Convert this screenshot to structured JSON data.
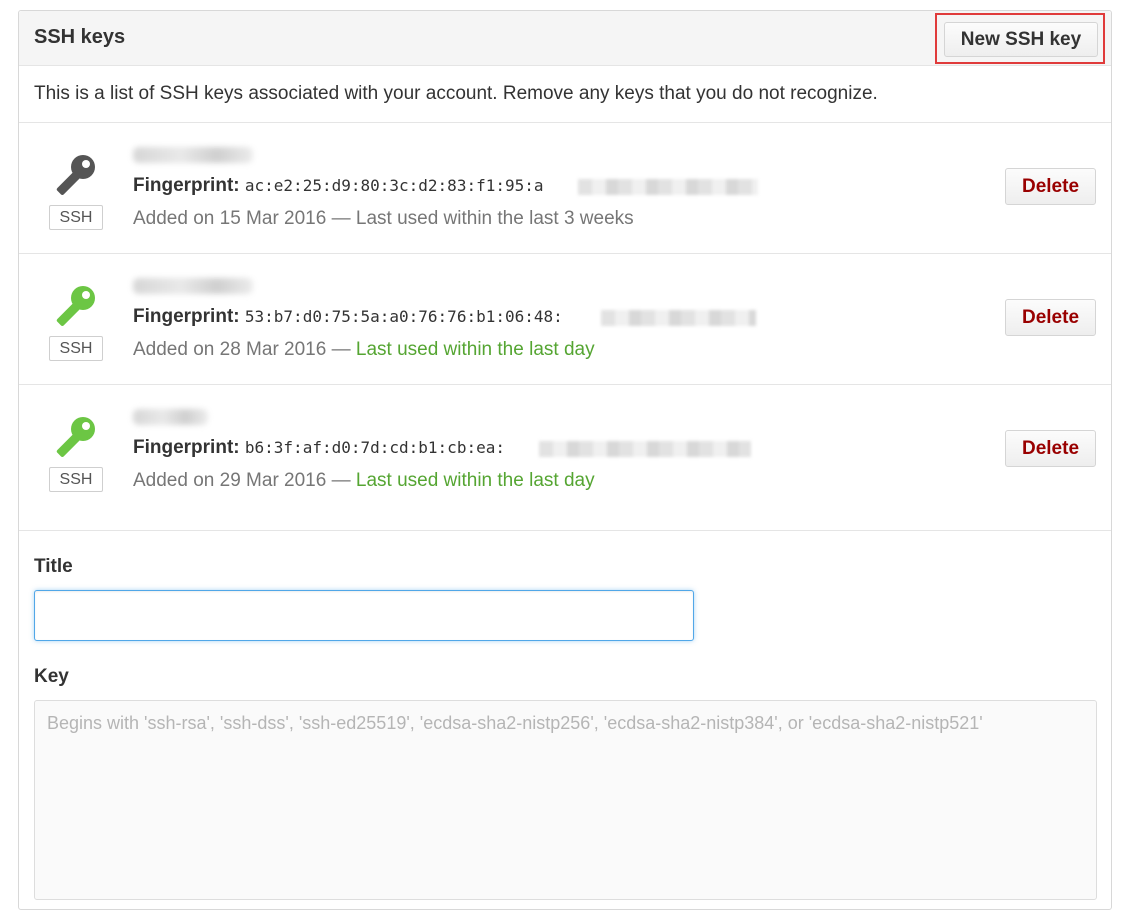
{
  "header": {
    "title": "SSH keys",
    "new_key_label": "New SSH key"
  },
  "intro": "This is a list of SSH keys associated with your account. Remove any keys that you do not recognize.",
  "keys": [
    {
      "type_label": "SSH",
      "icon_color": "#555555",
      "fingerprint_label": "Fingerprint:",
      "fingerprint_visible": "ac:e2:25:d9:80:3c:d2:83:f1:95:a",
      "added_prefix": "Added on 15 Mar 2016 — ",
      "last_used": "Last used within the last 3 weeks",
      "recent": false,
      "delete_label": "Delete"
    },
    {
      "type_label": "SSH",
      "icon_color": "#6cc644",
      "fingerprint_label": "Fingerprint:",
      "fingerprint_visible": "53:b7:d0:75:5a:a0:76:76:b1:06:48:",
      "added_prefix": "Added on 28 Mar 2016 — ",
      "last_used": "Last used within the last day",
      "recent": true,
      "delete_label": "Delete"
    },
    {
      "type_label": "SSH",
      "icon_color": "#6cc644",
      "fingerprint_label": "Fingerprint:",
      "fingerprint_visible": "b6:3f:af:d0:7d:cd:b1:cb:ea:",
      "added_prefix": "Added on 29 Mar 2016 — ",
      "last_used": "Last used within the last day",
      "recent": true,
      "delete_label": "Delete"
    }
  ],
  "form": {
    "title_label": "Title",
    "title_value": "",
    "key_label": "Key",
    "key_placeholder": "Begins with 'ssh-rsa', 'ssh-dss', 'ssh-ed25519', 'ecdsa-sha2-nistp256', 'ecdsa-sha2-nistp384', or 'ecdsa-sha2-nistp521'"
  },
  "colors": {
    "highlight_border": "#e03b3b",
    "delete_text": "#990000",
    "recent_green": "#55a532",
    "focus_blue": "#51a7e8"
  }
}
